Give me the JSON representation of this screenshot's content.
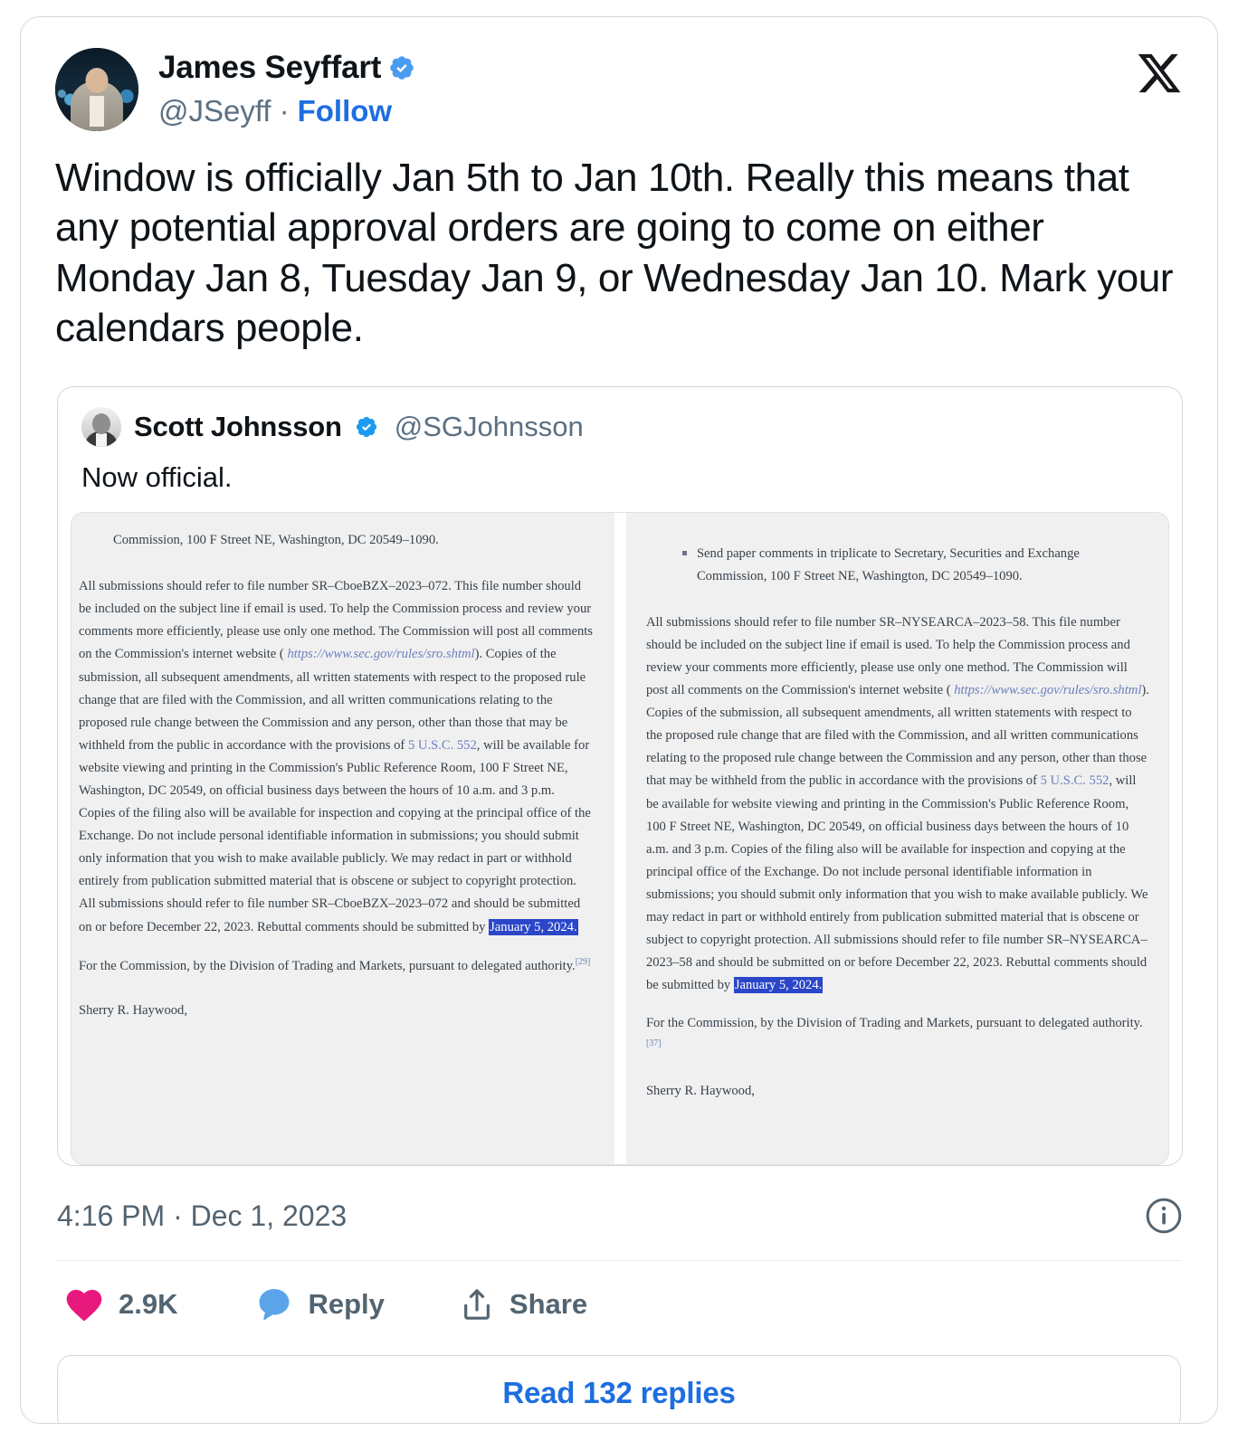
{
  "card": {
    "brand_logo": "x-logo",
    "accent_blue": "#1d6ee0",
    "like_pink": "#e8197d",
    "reply_blue": "#5ba4ea",
    "highlight_blue": "#2b46c8"
  },
  "author": {
    "display_name": "James Seyffart",
    "verified_badge": "verified-badge-icon",
    "handle": "@JSeyff",
    "separator": "·",
    "follow_label": "Follow",
    "avatar": "avatar-james-seyffart"
  },
  "tweet": {
    "text": "Window is officially Jan 5th to Jan 10th. Really this means that any potential approval orders are going to come on either Monday Jan 8, Tuesday Jan 9, or Wednesday Jan 10. Mark your calendars people."
  },
  "quoted_tweet": {
    "display_name": "Scott Johnsson",
    "verified_badge": "verified-badge-icon",
    "handle": "@SGJohnsson",
    "text": "Now official.",
    "avatar": "avatar-scott-johnsson"
  },
  "document_image": {
    "alt": "SEC Federal Register notice screenshots, two columns",
    "left_column": {
      "heading": "Commission, 100 F Street NE, Washington, DC 20549–1090.",
      "paragraph_1_part_1": "All submissions should refer to file number SR–CboeBZX–2023–072. This file number should be included on the subject line if email is used. To help the Commission process and review your comments more efficiently, please use only one method. The Commission will post all comments on the Commission's internet website ( ",
      "url": "https://www.sec.gov/rules/sro.shtml",
      "paragraph_1_part_2": "). Copies of the submission, all subsequent amendments, all written statements with respect to the proposed rule change that are filed with the Commission, and all written communications relating to the proposed rule change between the Commission and any person, other than those that may be withheld from the public in accordance with the provisions of ",
      "statute_link": "5 U.S.C. 552",
      "paragraph_1_part_3": ", will be available for website viewing and printing in the Commission's Public Reference Room, 100 F Street NE, Washington, DC 20549, on official business days between the hours of 10 a.m. and 3 p.m. Copies of the filing also will be available for inspection and copying at the principal office of the Exchange. Do not include personal identifiable information in submissions; you should submit only information that you wish to make available publicly. We may redact in part or withhold entirely from publication submitted material that is obscene or subject to copyright protection. All submissions should refer to file number SR–CboeBZX–2023–072 and should be submitted on or before December 22, 2023. Rebuttal comments should be submitted by ",
      "highlighted_date": "January 5, 2024.",
      "closing": "For the Commission, by the Division of Trading and Markets, pursuant to delegated authority.",
      "footnote": "[29]",
      "signature": "Sherry R. Haywood,"
    },
    "right_column": {
      "bullet": "Send paper comments in triplicate to Secretary, Securities and Exchange Commission, 100 F Street NE, Washington, DC 20549–1090.",
      "paragraph_1_part_1": "All submissions should refer to file number SR–NYSEARCA–2023–58. This file number should be included on the subject line if email is used. To help the Commission process and review your comments more efficiently, please use only one method. The Commission will post all comments on the Commission's internet website ( ",
      "url": "https://www.sec.gov/rules/sro.shtml",
      "paragraph_1_part_2": "). Copies of the submission, all subsequent amendments, all written statements with respect to the proposed rule change that are filed with the Commission, and all written communications relating to the proposed rule change between the Commission and any person, other than those that may be withheld from the public in accordance with the provisions of ",
      "statute_link": "5 U.S.C. 552",
      "paragraph_1_part_3": ", will be available for website viewing and printing in the Commission's Public Reference Room, 100 F Street NE, Washington, DC 20549, on official business days between the hours of 10 a.m. and 3 p.m. Copies of the filing also will be available for inspection and copying at the principal office of the Exchange. Do not include personal identifiable information in submissions; you should submit only information that you wish to make available publicly. We may redact in part or withhold entirely from publication submitted material that is obscene or subject to copyright protection. All submissions should refer to file number SR–NYSEARCA–2023–58 and should be submitted on or before December 22, 2023. Rebuttal comments should be submitted by ",
      "highlighted_date": "January 5, 2024.",
      "closing": "For the Commission, by the Division of Trading and Markets, pursuant to delegated authority.",
      "footnote": "[37]",
      "signature": "Sherry R. Haywood,"
    }
  },
  "meta": {
    "timestamp": "4:16 PM · Dec 1, 2023",
    "info_icon": "info-circle-icon"
  },
  "actions": {
    "like": {
      "icon": "heart-icon",
      "count": "2.9K"
    },
    "reply": {
      "icon": "speech-bubble-icon",
      "label": "Reply"
    },
    "share": {
      "icon": "share-arrow-icon",
      "label": "Share"
    }
  },
  "footer": {
    "read_replies_label": "Read 132 replies"
  }
}
